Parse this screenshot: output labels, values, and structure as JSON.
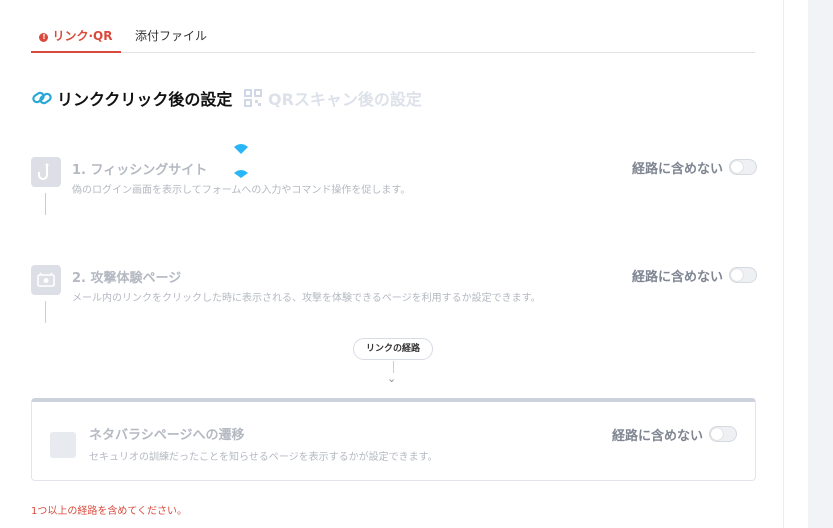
{
  "tabs": [
    {
      "label": "リンク·QR",
      "active": true,
      "has_alert": true
    },
    {
      "label": "添付ファイル",
      "active": false
    }
  ],
  "modes": {
    "link_label": "リンククリック後の設定",
    "qr_label": "QRスキャン後の設定"
  },
  "steps": [
    {
      "title": "1. フィッシングサイト",
      "description": "偽のログイン画面を表示してフォームへの入力やコマンド操作を促します。",
      "toggle_label": "経路に含めない",
      "toggle_on": false,
      "icon": "hook-icon"
    },
    {
      "title": "2. 攻撃体験ページ",
      "description": "メール内のリンクをクリックした時に表示される、攻撃を体験できるページを利用するか設定できます。",
      "toggle_label": "経路に含めない",
      "toggle_on": false,
      "icon": "alert-screen-icon"
    }
  ],
  "route_badge": "リンクの経路",
  "reveal_card": {
    "title": "ネタバラシページへの遷移",
    "description": "セキュリオの訓練だったことを知らせるページを表示するかが設定できます。",
    "toggle_label": "経路に含めない",
    "toggle_on": false
  },
  "error_message": "1つ以上の経路を含めてください。",
  "colors": {
    "accent": "#d94a3c",
    "link_icon": "#2aa8d8",
    "disabled_text": "#b4b9c2"
  }
}
